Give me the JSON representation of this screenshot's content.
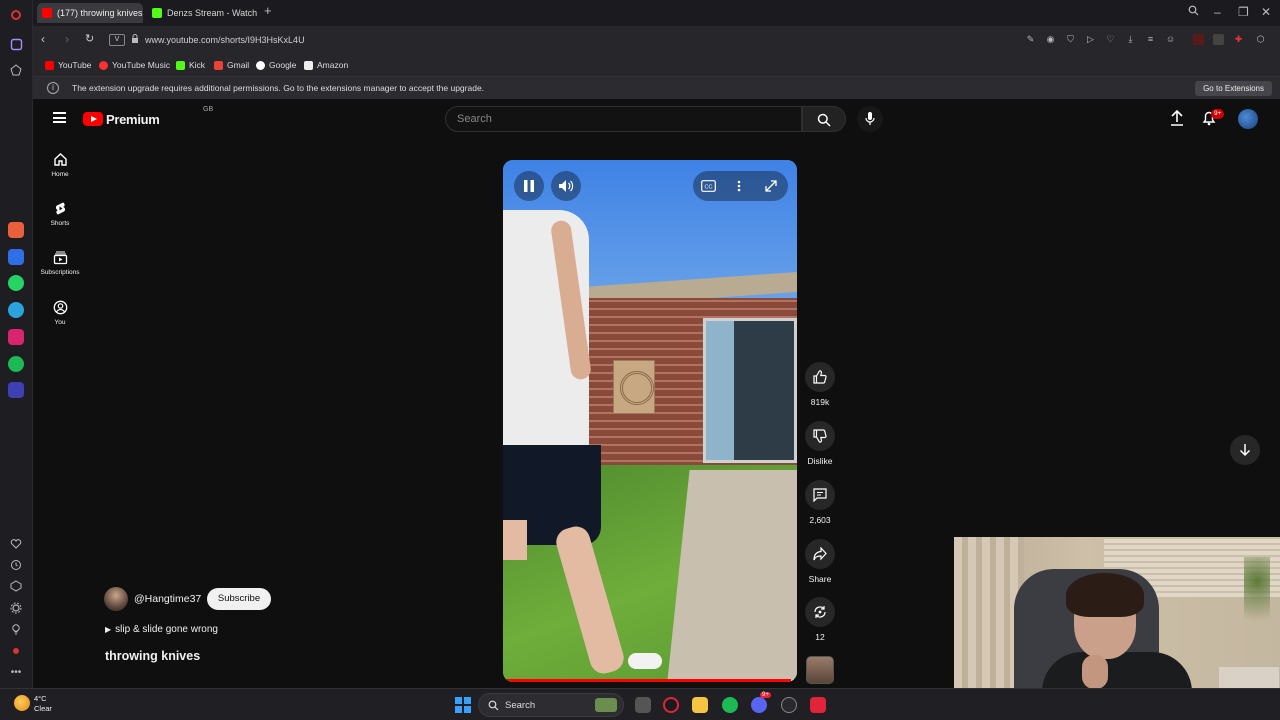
{
  "browser": {
    "tabs": [
      {
        "title": "(177) throwing knives",
        "active": true
      },
      {
        "title": "Denzs Stream - Watch Live",
        "active": false
      }
    ],
    "url": "www.youtube.com/shorts/I9H3HsKxL4U",
    "site_badge": "V",
    "bookmarks": [
      {
        "label": "YouTube",
        "color": "#ff0000"
      },
      {
        "label": "YouTube Music",
        "color": "#ff3030"
      },
      {
        "label": "Kick",
        "color": "#53fc18"
      },
      {
        "label": "Gmail",
        "color": "#ea4335"
      },
      {
        "label": "Google",
        "color": "#ffffff"
      },
      {
        "label": "Amazon",
        "color": "#eeeeee"
      }
    ],
    "notice": {
      "text": "The extension upgrade requires additional permissions. Go to the extensions manager to accept the upgrade.",
      "button": "Go to Extensions"
    }
  },
  "youtube": {
    "logo_text": "Premium",
    "logo_sup": "GB",
    "search_placeholder": "Search",
    "notification_count": "9+",
    "nav": [
      {
        "label": "Home",
        "icon": "home-icon"
      },
      {
        "label": "Shorts",
        "icon": "shorts-icon"
      },
      {
        "label": "Subscriptions",
        "icon": "subscriptions-icon"
      },
      {
        "label": "You",
        "icon": "you-icon"
      }
    ],
    "short": {
      "channel": "@Hangtime37",
      "subscribe_label": "Subscribe",
      "playlist": "slip & slide gone wrong",
      "title": "throwing knives",
      "progress": 0.98
    },
    "actions": {
      "likes": "819k",
      "dislike_label": "Dislike",
      "comments": "2,603",
      "share_label": "Share",
      "remix": "12"
    }
  },
  "taskbar": {
    "temperature": "4°C",
    "condition": "Clear",
    "search_label": "Search",
    "discord_badge": "9+"
  },
  "colors": {
    "youtube_red": "#ff0000",
    "background": "#0f0f0f"
  }
}
